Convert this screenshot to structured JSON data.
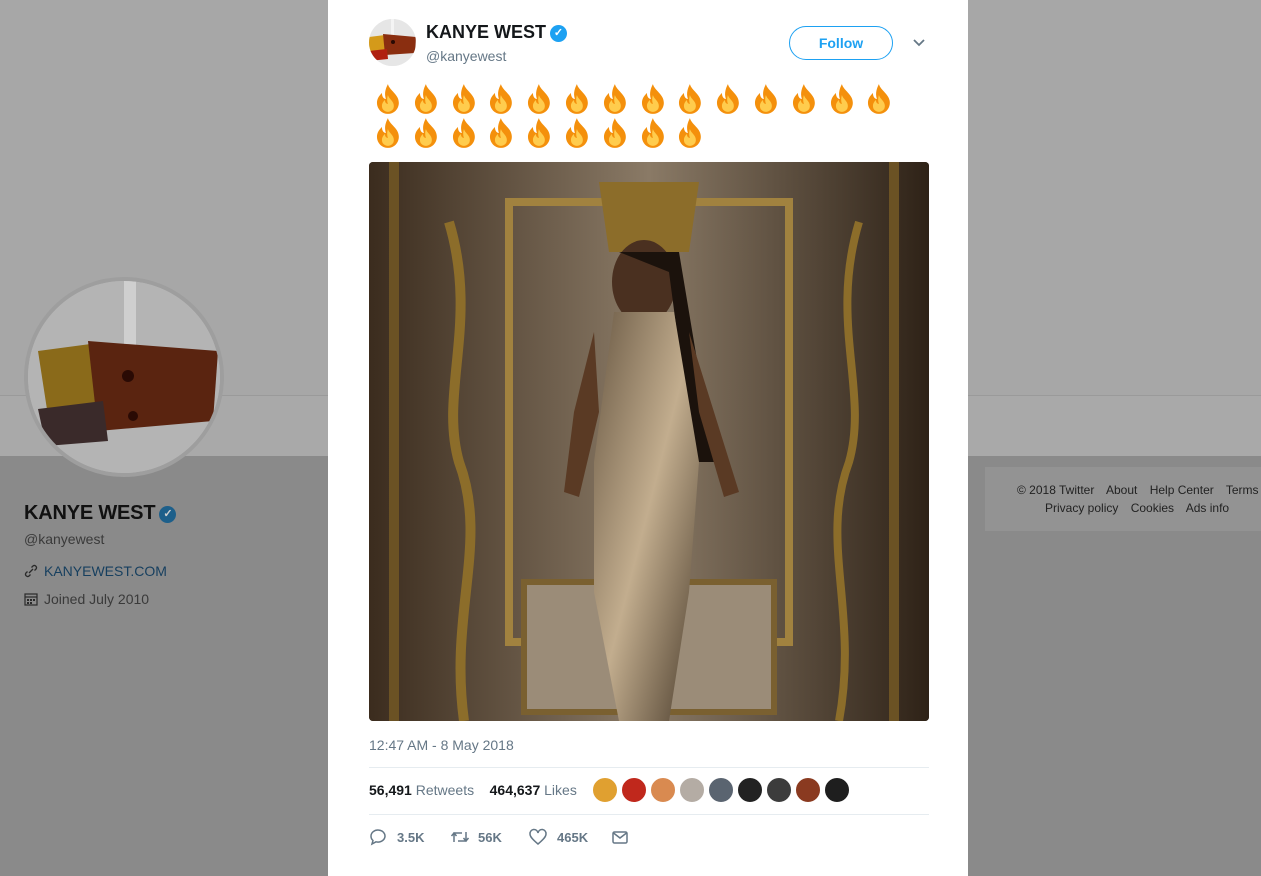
{
  "background_profile": {
    "name": "KANYE WEST",
    "handle": "@kanyewest",
    "website": "KANYEWEST.COM",
    "joined": "Joined July 2010",
    "footer": {
      "copyright": "© 2018 Twitter",
      "links_row1": [
        "About",
        "Help Center",
        "Terms"
      ],
      "links_row2": [
        "Privacy policy",
        "Cookies",
        "Ads info"
      ]
    }
  },
  "tweet": {
    "author_name": "KANYE WEST",
    "author_handle": "@kanyewest",
    "verified_icon": "✓",
    "follow_label": "Follow",
    "emoji_icon": "fire-emoji",
    "emoji_count": 23,
    "timestamp": "12:47 AM - 8 May 2018",
    "retweets_count": "56,491",
    "retweets_label": "Retweets",
    "likes_count": "464,637",
    "likes_label": "Likes",
    "actions": {
      "reply_count": "3.5K",
      "retweet_count": "56K",
      "like_count": "465K"
    }
  },
  "colors": {
    "accent": "#1da1f2",
    "secondary_text": "#657786",
    "overlay_bg": "#8b8b8b"
  }
}
